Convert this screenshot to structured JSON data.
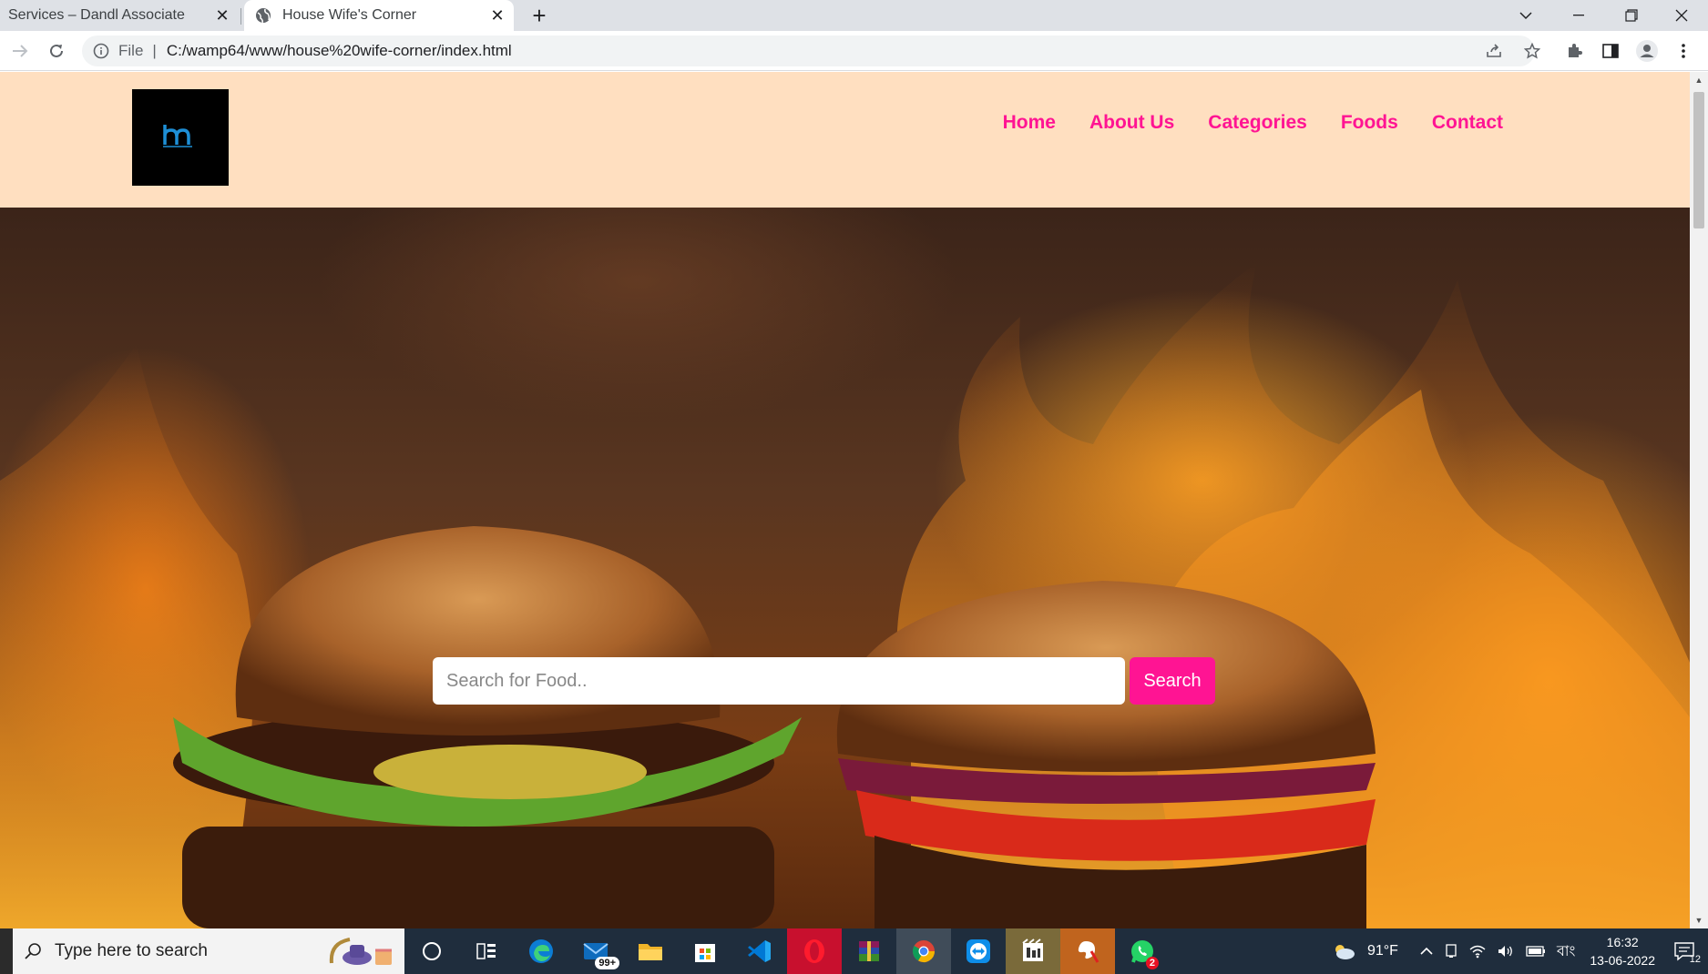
{
  "browser": {
    "tabs": [
      {
        "title": "Services – Dandl Associate",
        "active": false
      },
      {
        "title": "House Wife's Corner",
        "active": true
      }
    ],
    "address": {
      "scheme_label": "File",
      "url": "C:/wamp64/www/house%20wife-corner/index.html"
    }
  },
  "site": {
    "nav": [
      "Home",
      "About Us",
      "Categories",
      "Foods",
      "Contact"
    ],
    "search": {
      "placeholder": "Search for Food..",
      "button_label": "Search"
    }
  },
  "taskbar": {
    "search_placeholder": "Type here to search",
    "mail_badge": "99+",
    "whatsapp_badge": "2",
    "weather": "91°F",
    "language": "বাং",
    "time": "16:32",
    "date": "13-06-2022",
    "notification_count": "12"
  },
  "colors": {
    "accent": "#ff1493",
    "header_bg": "#ffdfc0"
  }
}
